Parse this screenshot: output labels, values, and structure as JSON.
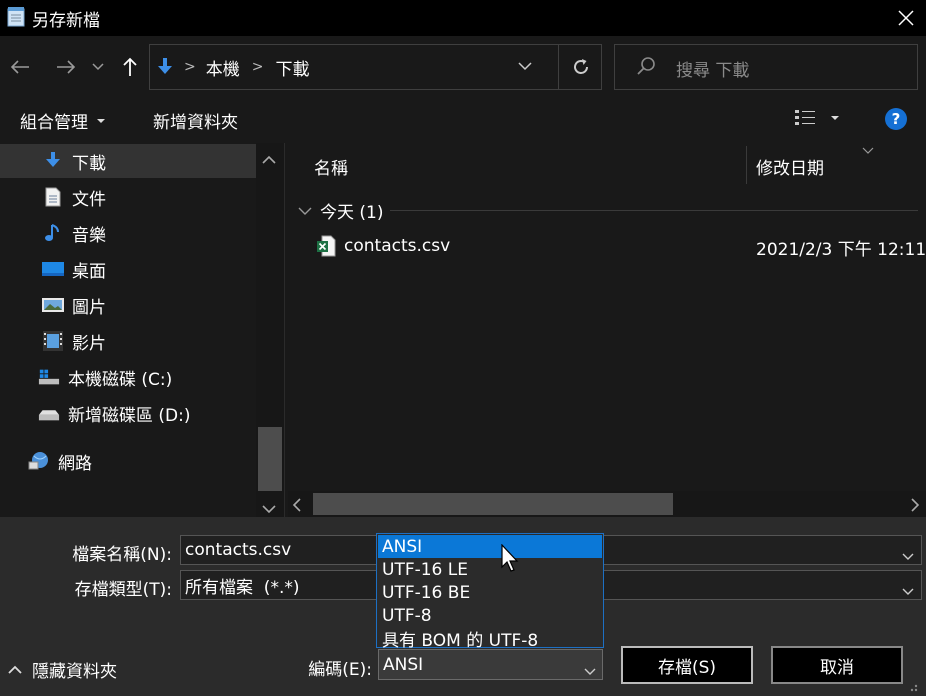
{
  "window": {
    "title": "另存新檔"
  },
  "nav": {
    "breadcrumb": [
      "本機",
      "下載"
    ],
    "search_placeholder": "搜尋 下載"
  },
  "toolbar": {
    "organize": "組合管理",
    "new_folder": "新增資料夾",
    "help": "?"
  },
  "sidebar": {
    "items": [
      {
        "label": "下載",
        "icon": "download-icon"
      },
      {
        "label": "文件",
        "icon": "document-icon"
      },
      {
        "label": "音樂",
        "icon": "music-icon"
      },
      {
        "label": "桌面",
        "icon": "desktop-icon"
      },
      {
        "label": "圖片",
        "icon": "pictures-icon"
      },
      {
        "label": "影片",
        "icon": "videos-icon"
      },
      {
        "label": "本機磁碟 (C:)",
        "icon": "drive-c-icon"
      },
      {
        "label": "新增磁碟區 (D:)",
        "icon": "drive-d-icon"
      },
      {
        "label": "網路",
        "icon": "network-icon"
      }
    ]
  },
  "files": {
    "columns": [
      "名稱",
      "修改日期"
    ],
    "group": "今天 (1)",
    "rows": [
      {
        "name": "contacts.csv",
        "modified": "2021/2/3 下午 12:11",
        "icon": "excel-csv-icon"
      }
    ]
  },
  "form": {
    "filename_label": "檔案名稱(N):",
    "filename_value": "contacts.csv",
    "type_label": "存檔類型(T):",
    "type_value": "所有檔案  (*.*)",
    "encoding_label": "編碼(E):",
    "encoding_value": "ANSI",
    "encoding_options": [
      "ANSI",
      "UTF-16 LE",
      "UTF-16 BE",
      "UTF-8",
      "具有 BOM 的 UTF-8"
    ],
    "hide_folders": "隱藏資料夾",
    "save": "存檔(S)",
    "cancel": "取消"
  },
  "colors": {
    "accent": "#0b78d7",
    "help": "#1570d4",
    "folder_arrow": "#3d8fe8"
  }
}
